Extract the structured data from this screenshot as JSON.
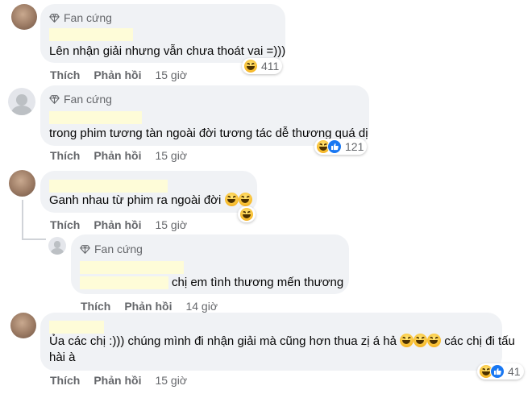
{
  "badge_label": "Fan cứng",
  "actions": {
    "like": "Thích",
    "reply": "Phản hồi"
  },
  "comments": [
    {
      "badge": true,
      "text": "Lên nhận giải nhưng vẫn chưa thoát vai =)))",
      "time": "15 giờ",
      "reaction_count": "411",
      "reactions": [
        "haha"
      ]
    },
    {
      "badge": true,
      "text": "trong phim tương tàn ngoài đời tương tác dễ thương quá dị",
      "time": "15 giờ",
      "reaction_count": "121",
      "reactions": [
        "haha",
        "like"
      ]
    },
    {
      "badge": false,
      "text": "Ganh nhau từ phim ra ngoài đời",
      "time": "15 giờ",
      "reactions": [
        "haha"
      ]
    },
    {
      "badge": true,
      "text": "chị em tình thương mến thương",
      "time": "14 giờ",
      "reply": true
    },
    {
      "badge": false,
      "text_line1": "Ủa các chị :))) chúng mình đi nhận giải mà cũng hơn thua zị á hả",
      "text_line1_tail": "các chị đi tấu",
      "text_line2": "hài à",
      "time": "15 giờ",
      "reaction_count": "41",
      "reactions": [
        "haha",
        "like"
      ]
    }
  ],
  "colors": {
    "bubble": "#f0f2f5",
    "secondary_text": "#65676b",
    "like_blue": "#1877f2",
    "haha_yellow": "#f7b928",
    "redaction": "#fefcd8"
  },
  "icons": [
    "diamond-icon",
    "haha-emoji",
    "like-icon"
  ]
}
